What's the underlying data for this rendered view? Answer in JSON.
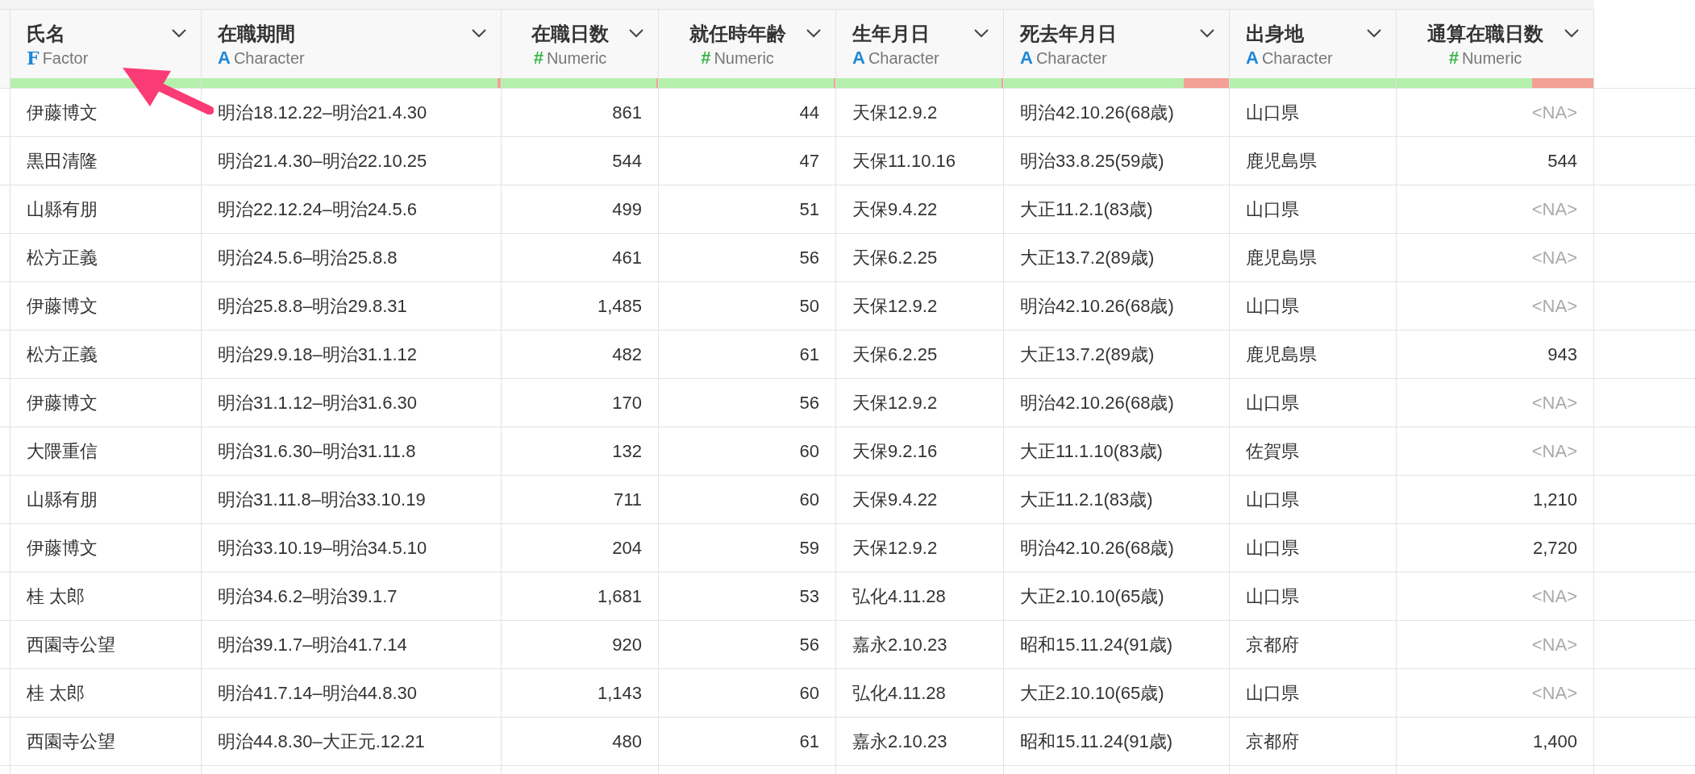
{
  "columns": [
    {
      "name": "氏名",
      "kind": "factor",
      "type_icon": "F",
      "type": "Factor",
      "level": 1
    },
    {
      "name": "在職期間",
      "kind": "character",
      "type_icon": "A",
      "type": "Character",
      "level": 0.99
    },
    {
      "name": "在職日数",
      "kind": "numeric",
      "type_icon": "#",
      "type": "Numeric",
      "level": 0.99
    },
    {
      "name": "就任時年齢",
      "kind": "numeric",
      "type_icon": "#",
      "type": "Numeric",
      "level": 0.99
    },
    {
      "name": "生年月日",
      "kind": "character",
      "type_icon": "A",
      "type": "Character",
      "level": 0.99
    },
    {
      "name": "死去年月日",
      "kind": "character",
      "type_icon": "A",
      "type": "Character",
      "level": 0.8
    },
    {
      "name": "出身地",
      "kind": "character",
      "type_icon": "A",
      "type": "Character",
      "level": 1
    },
    {
      "name": "通算在職日数",
      "kind": "numeric",
      "type_icon": "#",
      "type": "Numeric",
      "level": 0.69
    }
  ],
  "rows": [
    {
      "cells": [
        "伊藤博文",
        "明治18.12.22–明治21.4.30",
        "861",
        "44",
        "天保12.9.2",
        "明治42.10.26(68歳)",
        "山口県",
        "<NA>"
      ],
      "last_missing": true
    },
    {
      "cells": [
        "黒田清隆",
        "明治21.4.30–明治22.10.25",
        "544",
        "47",
        "天保11.10.16",
        "明治33.8.25(59歳)",
        "鹿児島県",
        "544"
      ],
      "last_missing": false
    },
    {
      "cells": [
        "山縣有朋",
        "明治22.12.24–明治24.5.6",
        "499",
        "51",
        "天保9.4.22",
        "大正11.2.1(83歳)",
        "山口県",
        "<NA>"
      ],
      "last_missing": true
    },
    {
      "cells": [
        "松方正義",
        "明治24.5.6–明治25.8.8",
        "461",
        "56",
        "天保6.2.25",
        "大正13.7.2(89歳)",
        "鹿児島県",
        "<NA>"
      ],
      "last_missing": true
    },
    {
      "cells": [
        "伊藤博文",
        "明治25.8.8–明治29.8.31",
        "1,485",
        "50",
        "天保12.9.2",
        "明治42.10.26(68歳)",
        "山口県",
        "<NA>"
      ],
      "last_missing": true
    },
    {
      "cells": [
        "松方正義",
        "明治29.9.18–明治31.1.12",
        "482",
        "61",
        "天保6.2.25",
        "大正13.7.2(89歳)",
        "鹿児島県",
        "943"
      ],
      "last_missing": false
    },
    {
      "cells": [
        "伊藤博文",
        "明治31.1.12–明治31.6.30",
        "170",
        "56",
        "天保12.9.2",
        "明治42.10.26(68歳)",
        "山口県",
        "<NA>"
      ],
      "last_missing": true
    },
    {
      "cells": [
        "大隈重信",
        "明治31.6.30–明治31.11.8",
        "132",
        "60",
        "天保9.2.16",
        "大正11.1.10(83歳)",
        "佐賀県",
        "<NA>"
      ],
      "last_missing": true
    },
    {
      "cells": [
        "山縣有朋",
        "明治31.11.8–明治33.10.19",
        "711",
        "60",
        "天保9.4.22",
        "大正11.2.1(83歳)",
        "山口県",
        "1,210"
      ],
      "last_missing": false
    },
    {
      "cells": [
        "伊藤博文",
        "明治33.10.19–明治34.5.10",
        "204",
        "59",
        "天保12.9.2",
        "明治42.10.26(68歳)",
        "山口県",
        "2,720"
      ],
      "last_missing": false
    },
    {
      "cells": [
        "桂 太郎",
        "明治34.6.2–明治39.1.7",
        "1,681",
        "53",
        "弘化4.11.28",
        "大正2.10.10(65歳)",
        "山口県",
        "<NA>"
      ],
      "last_missing": true
    },
    {
      "cells": [
        "西園寺公望",
        "明治39.1.7–明治41.7.14",
        "920",
        "56",
        "嘉永2.10.23",
        "昭和15.11.24(91歳)",
        "京都府",
        "<NA>"
      ],
      "last_missing": true
    },
    {
      "cells": [
        "桂 太郎",
        "明治41.7.14–明治44.8.30",
        "1,143",
        "60",
        "弘化4.11.28",
        "大正2.10.10(65歳)",
        "山口県",
        "<NA>"
      ],
      "last_missing": true
    },
    {
      "cells": [
        "西園寺公望",
        "明治44.8.30–大正元.12.21",
        "480",
        "61",
        "嘉永2.10.23",
        "昭和15.11.24(91歳)",
        "京都府",
        "1,400"
      ],
      "last_missing": false
    }
  ]
}
